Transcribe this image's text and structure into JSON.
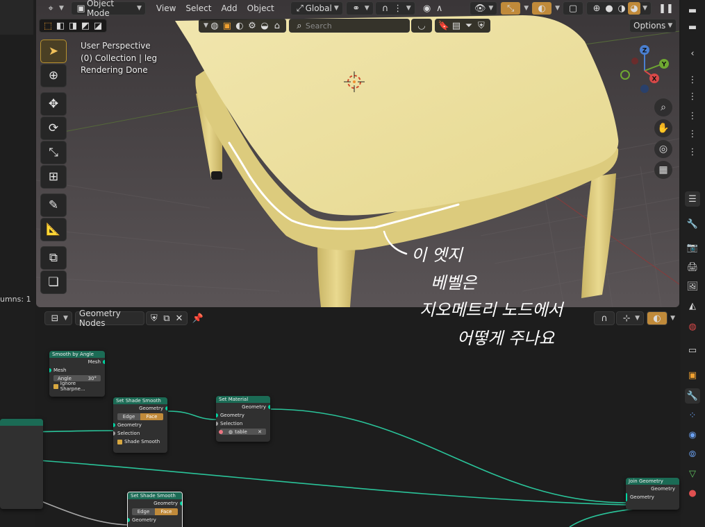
{
  "header": {
    "mode": "Object Mode",
    "menus": [
      "View",
      "Select",
      "Add",
      "Object"
    ],
    "transform_orientation": "Global",
    "options_label": "Options",
    "search_placeholder": "Search"
  },
  "viewport": {
    "overlay": [
      "User Perspective",
      "(0) Collection | leg",
      "Rendering Done"
    ],
    "gizmo": {
      "z": "Z",
      "y": "Y",
      "x": "X"
    }
  },
  "left_strip": {
    "columns_label": "umns: 1"
  },
  "node_editor": {
    "tree_name": "Geometry Nodes",
    "nodes": {
      "smooth_by_angle": {
        "title": "Smooth by Angle",
        "out": "Mesh",
        "in_mesh": "Mesh",
        "angle_label": "Angle",
        "angle_value": "30°",
        "ignore": "Ignore Sharpne..."
      },
      "set_shade_smooth_1": {
        "title": "Set Shade Smooth",
        "out": "Geometry",
        "seg": [
          "Edge",
          "Face"
        ],
        "geometry": "Geometry",
        "selection": "Selection",
        "shade": "Shade Smooth"
      },
      "set_material": {
        "title": "Set Material",
        "out": "Geometry",
        "geometry": "Geometry",
        "selection": "Selection",
        "material": "table"
      },
      "join_geometry": {
        "title": "Join Geometry",
        "out": "Geometry",
        "in": "Geometry"
      },
      "set_shade_smooth_2": {
        "title": "Set Shade Smooth",
        "out": "Geometry",
        "seg": [
          "Edge",
          "Face"
        ],
        "geometry": "Geometry"
      }
    }
  },
  "annotation": [
    "이 엣지",
    "베벨은",
    "지오메트리 노드에서",
    "어떻게 주나요"
  ],
  "colors": {
    "accent": "#f0a030",
    "node_header": "#1b6b55",
    "socket_geometry": "#00d6a3",
    "table": "#ecdf9c"
  }
}
